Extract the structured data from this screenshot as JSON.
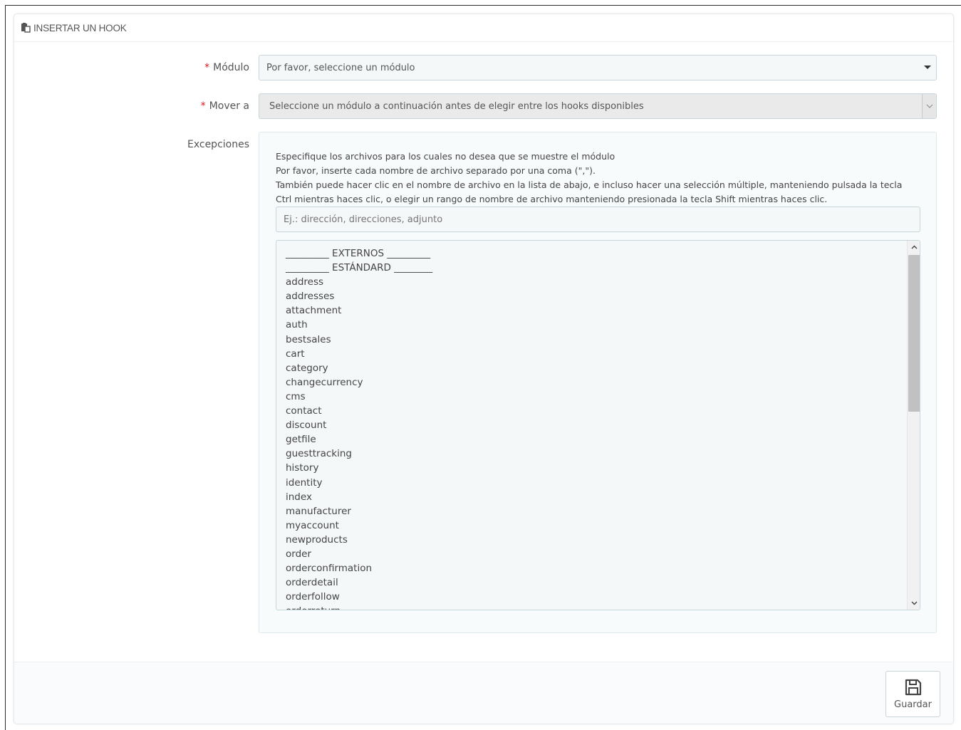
{
  "panel": {
    "title": "INSERTAR UN HOOK",
    "title_icon": "paste-icon"
  },
  "form": {
    "module": {
      "label": "Módulo",
      "required_mark": "*",
      "selected": "Por favor, seleccione un módulo"
    },
    "move_to": {
      "label": "Mover a",
      "required_mark": "*",
      "selected": "Seleccione un módulo a continuación antes de elegir entre los hooks disponibles"
    },
    "exceptions": {
      "label": "Excepciones",
      "help_lines": [
        "Especifique los archivos para los cuales no desea que se muestre el módulo",
        "Por favor, inserte cada nombre de archivo separado por una coma (\",\").",
        "También puede hacer clic en el nombre de archivo en la lista de abajo, e incluso hacer una selección múltiple, manteniendo pulsada la tecla Ctrl mientras haces clic, o elegir un rango de nombre de archivo manteniendo presionada la tecla Shift mientras haces clic."
      ],
      "input_placeholder": "Ej.: dirección, direcciones, adjunto",
      "list_items": [
        "_________ EXTERNOS _________",
        "_________ ESTÁNDARD ________",
        "address",
        "addresses",
        "attachment",
        "auth",
        "bestsales",
        "cart",
        "category",
        "changecurrency",
        "cms",
        "contact",
        "discount",
        "getfile",
        "guesttracking",
        "history",
        "identity",
        "index",
        "manufacturer",
        "myaccount",
        "newproducts",
        "order",
        "orderconfirmation",
        "orderdetail",
        "orderfollow",
        "orderreturn"
      ]
    }
  },
  "footer": {
    "save_label": "Guardar",
    "save_icon": "floppy-disk-icon"
  }
}
